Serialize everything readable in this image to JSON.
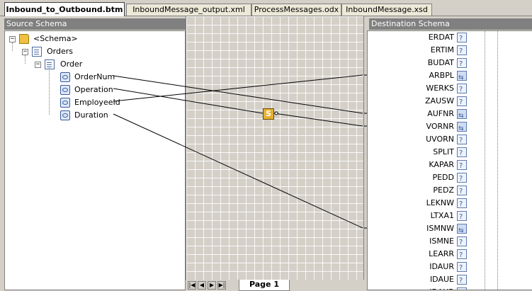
{
  "tabs": [
    {
      "label": "Inbound_to_Outbound.btm"
    },
    {
      "label": "InboundMessage_output.xml"
    },
    {
      "label": "ProcessMessages.odx"
    },
    {
      "label": "InboundMessage.xsd"
    }
  ],
  "source": {
    "header": "Source Schema",
    "schema_label": "<Schema>",
    "orders_label": "Orders",
    "order_label": "Order",
    "fields": [
      "OrderNum",
      "Operation",
      "EmployeeId",
      "Duration"
    ]
  },
  "destination": {
    "header": "Destination Schema",
    "fields": [
      "ERDAT",
      "ERTIM",
      "BUDAT",
      "ARBPL",
      "WERKS",
      "ZAUSW",
      "AUFNR",
      "VORNR",
      "UVORN",
      "SPLIT",
      "KAPAR",
      "PEDD",
      "PEDZ",
      "LEKNW",
      "LTXA1",
      "ISMNW",
      "ISMNE",
      "LEARR",
      "IDAUR",
      "IDAUE",
      "IDAUR"
    ],
    "linked": [
      "ARBPL",
      "AUFNR",
      "VORNR",
      "ISMNW"
    ]
  },
  "functoid": {
    "symbol": "S",
    "icon": "string-concatenate-functoid-icon"
  },
  "pager": {
    "page_label": "Page 1"
  }
}
